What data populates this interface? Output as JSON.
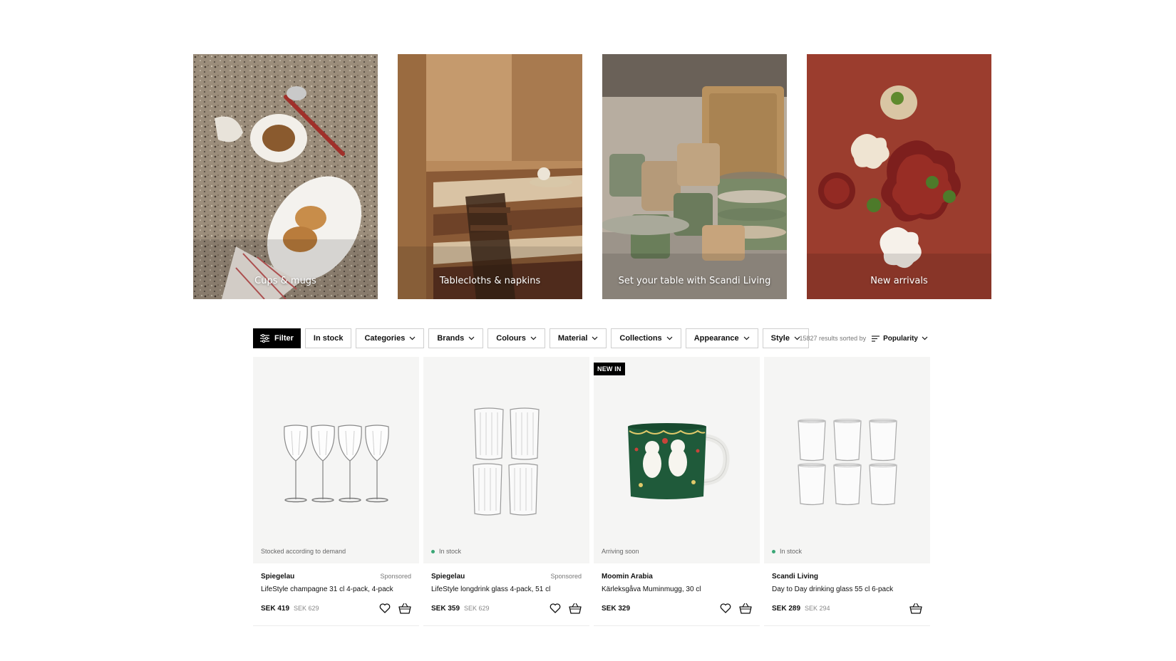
{
  "categories": [
    {
      "label": "Cups & mugs"
    },
    {
      "label": "Tablecloths & napkins"
    },
    {
      "label": "Set your table with Scandi Living"
    },
    {
      "label": "New arrivals"
    }
  ],
  "filters": {
    "filter_label": "Filter",
    "chips": [
      "In stock",
      "Categories",
      "Brands",
      "Colours",
      "Material",
      "Collections",
      "Appearance",
      "Style"
    ]
  },
  "sort": {
    "results_text": "15827 results sorted by",
    "sort_value": "Popularity"
  },
  "products": [
    {
      "brand": "Spiegelau",
      "sponsored": "Sponsored",
      "name": "LifeStyle champagne 31 cl 4-pack, 4-pack",
      "price": "SEK 419",
      "old_price": "SEK 629",
      "stock": "Stocked according to demand"
    },
    {
      "brand": "Spiegelau",
      "sponsored": "Sponsored",
      "name": "LifeStyle longdrink glass 4-pack, 51 cl",
      "price": "SEK 359",
      "old_price": "SEK 629",
      "stock": "In stock"
    },
    {
      "brand": "Moomin Arabia",
      "sponsored": "",
      "name": "Kärleksgåva Muminmugg, 30 cl",
      "price": "SEK 329",
      "old_price": "",
      "stock": "Arriving soon",
      "badge": "NEW IN"
    },
    {
      "brand": "Scandi Living",
      "sponsored": "",
      "name": "Day to Day drinking glass 55 cl 6-pack",
      "price": "SEK 289",
      "old_price": "SEK 294",
      "stock": "In stock"
    }
  ],
  "icons": {
    "filter": "sliders-icon",
    "sort": "sort-lines-icon",
    "wishlist": "heart-icon",
    "cart": "basket-icon"
  },
  "colors": {
    "accent": "#000000",
    "in_stock_dot": "#3aa776",
    "card_bg": "#f5f5f4",
    "new_arrivals_bg": "#9b3d2e"
  }
}
